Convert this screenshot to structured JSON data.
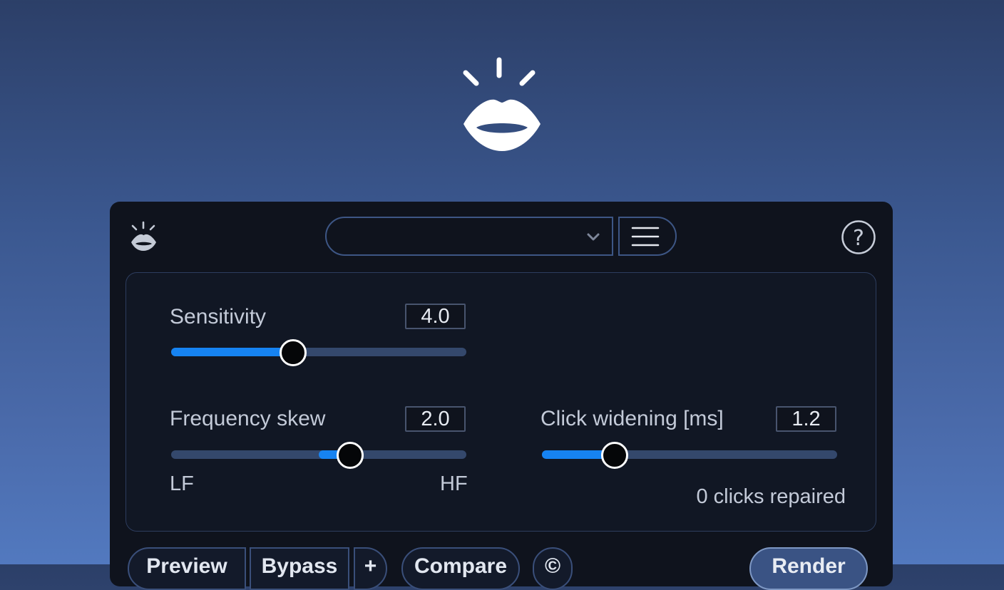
{
  "header": {
    "hero_logo_icon": "lips-logo-icon",
    "mini_logo_icon": "lips-logo-icon",
    "preset_dropdown_value": "",
    "menu_icon": "hamburger-menu-icon",
    "help_label": "?"
  },
  "controls": {
    "sensitivity": {
      "label": "Sensitivity",
      "value": "4.0",
      "fraction": 0.405
    },
    "frequency_skew": {
      "label": "Frequency skew",
      "value": "2.0",
      "fraction": 0.6,
      "center_fraction": 0.5,
      "low_label": "LF",
      "high_label": "HF"
    },
    "click_widening": {
      "label": "Click widening [ms]",
      "value": "1.2",
      "fraction": 0.24
    },
    "status": "0 clicks repaired"
  },
  "footer": {
    "preview_label": "Preview",
    "bypass_label": "Bypass",
    "plus_label": "+",
    "compare_label": "Compare",
    "copyright_label": "©",
    "render_label": "Render"
  },
  "colors": {
    "accent": "#1683f2",
    "track": "#34486c",
    "panel": "#0f131d"
  }
}
